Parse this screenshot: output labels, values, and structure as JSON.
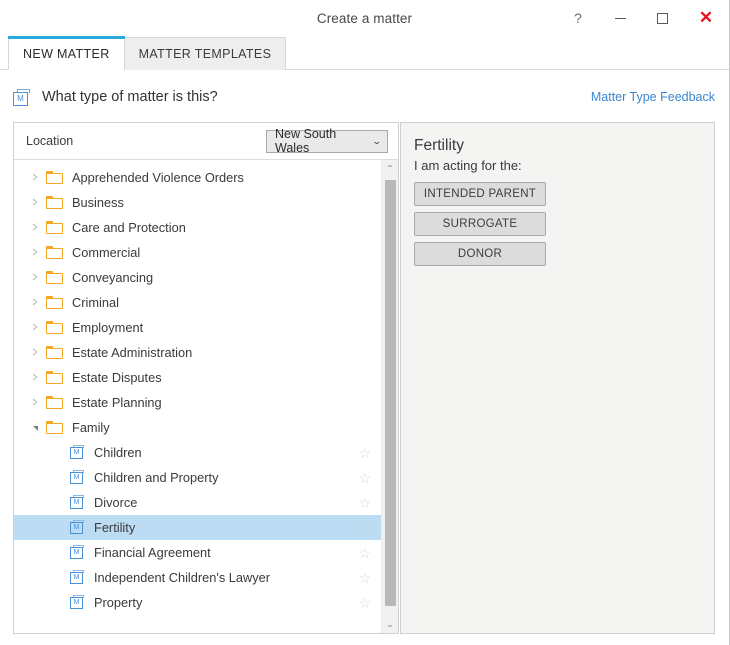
{
  "titlebar": {
    "title": "Create a matter",
    "help_label": "?",
    "minimize_label": "",
    "maximize_label": "",
    "close_label": "✕"
  },
  "tabs": [
    {
      "label": "NEW MATTER",
      "active": true
    },
    {
      "label": "MATTER TEMPLATES",
      "active": false
    }
  ],
  "question": {
    "icon": "matter-icon",
    "text": "What type of matter is this?",
    "feedback_link": "Matter Type Feedback"
  },
  "location": {
    "label": "Location",
    "selected": "New South Wales",
    "caret": "⌄"
  },
  "tree": {
    "items": [
      {
        "label": "Apprehended Violence Orders",
        "level": 1,
        "expanded": false,
        "selected": false,
        "star": false
      },
      {
        "label": "Business",
        "level": 1,
        "expanded": false,
        "selected": false,
        "star": false
      },
      {
        "label": "Care and Protection",
        "level": 1,
        "expanded": false,
        "selected": false,
        "star": false
      },
      {
        "label": "Commercial",
        "level": 1,
        "expanded": false,
        "selected": false,
        "star": false
      },
      {
        "label": "Conveyancing",
        "level": 1,
        "expanded": false,
        "selected": false,
        "star": false
      },
      {
        "label": "Criminal",
        "level": 1,
        "expanded": false,
        "selected": false,
        "star": false
      },
      {
        "label": "Employment",
        "level": 1,
        "expanded": false,
        "selected": false,
        "star": false
      },
      {
        "label": "Estate Administration",
        "level": 1,
        "expanded": false,
        "selected": false,
        "star": false
      },
      {
        "label": "Estate Disputes",
        "level": 1,
        "expanded": false,
        "selected": false,
        "star": false
      },
      {
        "label": "Estate Planning",
        "level": 1,
        "expanded": false,
        "selected": false,
        "star": false
      },
      {
        "label": "Family",
        "level": 1,
        "expanded": true,
        "selected": false,
        "star": false
      },
      {
        "label": "Children",
        "level": 2,
        "expanded": false,
        "selected": false,
        "star": true
      },
      {
        "label": "Children and Property",
        "level": 2,
        "expanded": false,
        "selected": false,
        "star": true
      },
      {
        "label": "Divorce",
        "level": 2,
        "expanded": false,
        "selected": false,
        "star": true
      },
      {
        "label": "Fertility",
        "level": 2,
        "expanded": false,
        "selected": true,
        "star": true
      },
      {
        "label": "Financial Agreement",
        "level": 2,
        "expanded": false,
        "selected": false,
        "star": true
      },
      {
        "label": "Independent Children's Lawyer",
        "level": 2,
        "expanded": false,
        "selected": false,
        "star": true
      },
      {
        "label": "Property",
        "level": 2,
        "expanded": false,
        "selected": false,
        "star": true
      }
    ],
    "star_glyph": "☆",
    "scroll_up_glyph": "⌃",
    "scroll_down_glyph": "⌄"
  },
  "detail": {
    "title": "Fertility",
    "subtitle": "I am acting for the:",
    "roles": [
      {
        "label": "INTENDED PARENT"
      },
      {
        "label": "SURROGATE"
      },
      {
        "label": "DONOR"
      }
    ]
  },
  "colors": {
    "accent_blue": "#29abe2",
    "link_blue": "#3b86d1",
    "folder_orange": "#f5a623",
    "matter_icon_blue": "#4a90d9",
    "selection_blue": "#bcdcf4",
    "close_red": "#e81123"
  }
}
